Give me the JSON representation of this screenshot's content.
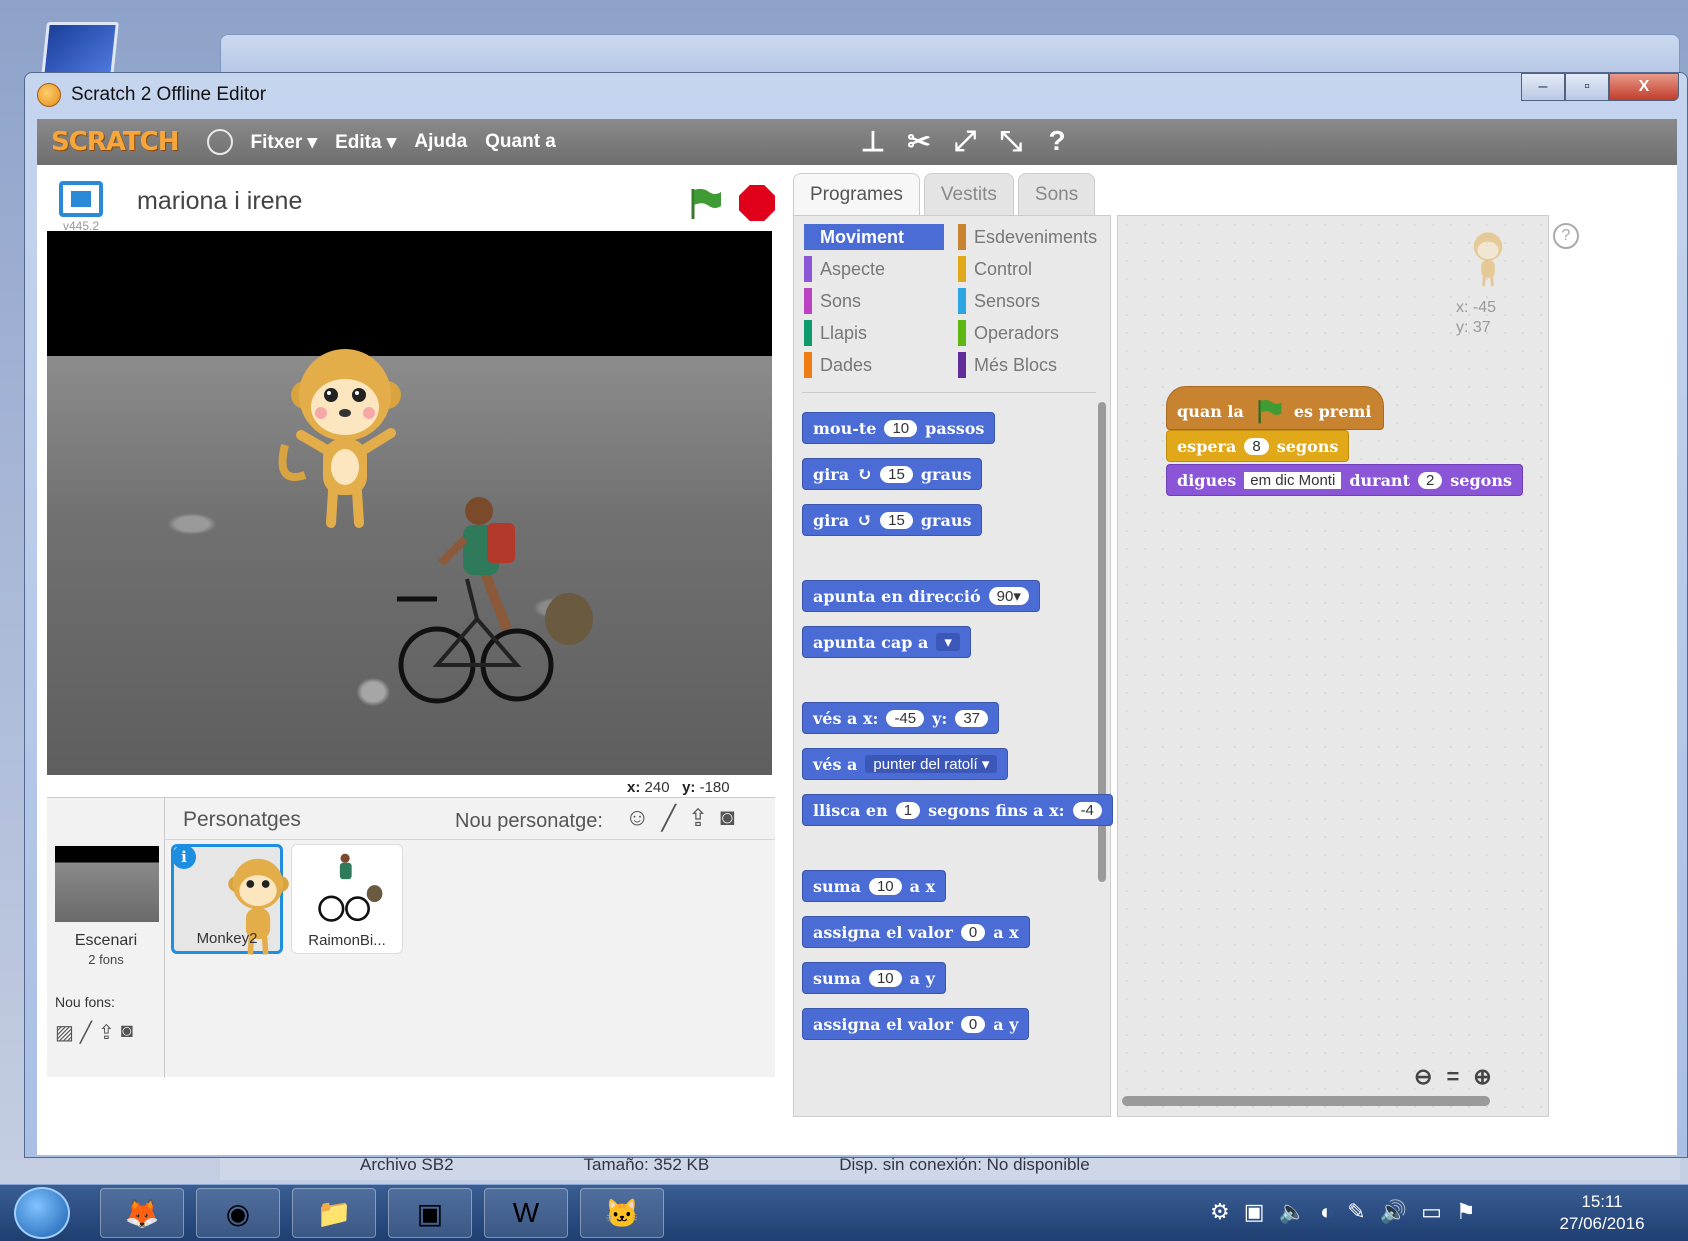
{
  "window": {
    "title": "Scratch 2 Offline Editor",
    "minimize": "–",
    "maximize": "▫",
    "close": "X"
  },
  "menubar": {
    "logo": "SCRATCH",
    "items": [
      "Fitxer ▾",
      "Edita ▾",
      "Ajuda",
      "Quant a"
    ]
  },
  "stage": {
    "project_title": "mariona i irene",
    "version": "v445.2",
    "mouse_x_label": "x:",
    "mouse_x": "240",
    "mouse_y_label": "y:",
    "mouse_y": "-180"
  },
  "sprites": {
    "label": "Personatges",
    "new_sprite_label": "Nou personatge:",
    "stage_name": "Escenari",
    "stage_sub": "2 fons",
    "new_bg_label": "Nou fons:",
    "items": [
      {
        "name": "Monkey2",
        "selected": true
      },
      {
        "name": "RaimonBi...",
        "selected": false
      }
    ],
    "info_badge": "i"
  },
  "tabs": [
    "Programes",
    "Vestits",
    "Sons"
  ],
  "categories": {
    "left": [
      "Moviment",
      "Aspecte",
      "Sons",
      "Llapis",
      "Dades"
    ],
    "right": [
      "Esdeveniments",
      "Control",
      "Sensors",
      "Operadors",
      "Més Blocs"
    ],
    "colors": {
      "Moviment": "#4a6cd4",
      "Aspecte": "#8a55d7",
      "Sons": "#bb42c3",
      "Llapis": "#0e9a6c",
      "Dades": "#ee7d16",
      "Esdeveniments": "#c88330",
      "Control": "#e1a91a",
      "Sensors": "#2ca5e2",
      "Operadors": "#5cb712",
      "Més Blocs": "#632d99"
    }
  },
  "palette_blocks": {
    "move": {
      "a": "mou-te",
      "n": "10",
      "b": "passos"
    },
    "turn_right": {
      "a": "gira",
      "icon": "↻",
      "n": "15",
      "b": "graus"
    },
    "turn_left": {
      "a": "gira",
      "icon": "↺",
      "n": "15",
      "b": "graus"
    },
    "point_dir": {
      "a": "apunta en direcció",
      "n": "90▾"
    },
    "point_to": {
      "a": "apunta cap a",
      "dd": "▾"
    },
    "goto_xy": {
      "a": "vés a x:",
      "x": "-45",
      "b": "y:",
      "y": "37"
    },
    "goto": {
      "a": "vés a",
      "dd": "punter del ratolí ▾"
    },
    "glide": {
      "a": "llisca en",
      "n": "1",
      "b": "segons fins a x:",
      "x": "-4"
    },
    "change_x": {
      "a": "suma",
      "n": "10",
      "b": "a x"
    },
    "set_x": {
      "a": "assigna el valor",
      "n": "0",
      "b": "a x"
    },
    "change_y": {
      "a": "suma",
      "n": "10",
      "b": "a y"
    },
    "set_y": {
      "a": "assigna el valor",
      "n": "0",
      "b": "a y"
    }
  },
  "script": {
    "hat": {
      "a": "quan la",
      "b": "es premi"
    },
    "wait": {
      "a": "espera",
      "n": "8",
      "b": "segons"
    },
    "say": {
      "a": "digues",
      "text": "em dic Monti",
      "b": "durant",
      "n": "2",
      "c": "segons"
    },
    "sprite_x": "x: -45",
    "sprite_y": "y: 37",
    "colors": {
      "event": "#c88330",
      "control": "#e1a91a",
      "looks": "#8a55d7"
    }
  },
  "background_window_status": [
    "Archivo SB2",
    "Tamaño: 352 KB",
    "Disp. sin conexión: No disponible"
  ],
  "taskbar": {
    "time": "15:11",
    "date": "27/06/2016"
  }
}
